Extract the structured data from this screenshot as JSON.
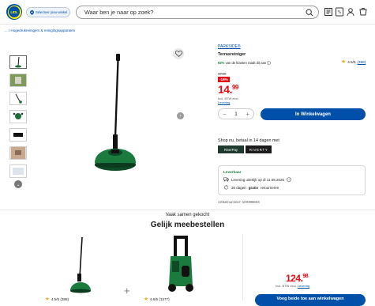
{
  "header": {
    "logo_text": "LIDL",
    "store_label": "Selecteer jouw winkel",
    "search_placeholder": "Waar ben je naar op zoek?"
  },
  "breadcrumb": "... / Hogedrukreinigers & reinigingsapparaten",
  "product": {
    "brand": "PARKSIDE®",
    "title": "Terrasreiniger",
    "rating": "4.5/5",
    "rating_count": "(388)",
    "recommend_pct": "92%",
    "recommend_text": "van de klanten raadt dit aan",
    "old_price": "17.99",
    "discount": "-16%",
    "price_int": "14",
    "price_dec": "99",
    "vat_text": "Incl. BTW excl.",
    "vat_link": "Levering",
    "quantity": "1",
    "cart_label": "In Winkelwagen",
    "pay_title": "Shop nu, betaal in 14 dagen met",
    "pay_logo": "RiverPay",
    "pay_logo2": "RIVERTY",
    "availability": "Leverbaar",
    "delivery_line": "Levering uiterlijk op di 11.08.2026",
    "returns_prefix": "30 dagen",
    "returns_bold": "gratis",
    "returns_suffix": "retourneren",
    "article": "Artikelnummer: 100398603"
  },
  "bundle": {
    "subtitle": "Vaak samen gekocht",
    "title": "Gelijk meebestellen",
    "item1_rating": "4.5/5 (388)",
    "item2_rating": "4.6/5 (1377)",
    "total_int": "124",
    "total_dec": "98",
    "vat_text": "Incl. BTW excl.",
    "vat_link": "Levering",
    "button_label": "Voeg beide toe aan winkelwagen"
  },
  "colors": {
    "accent": "#0050aa",
    "price_red": "#e60a14",
    "star": "#f5a623",
    "green": "#1b7a3e"
  }
}
